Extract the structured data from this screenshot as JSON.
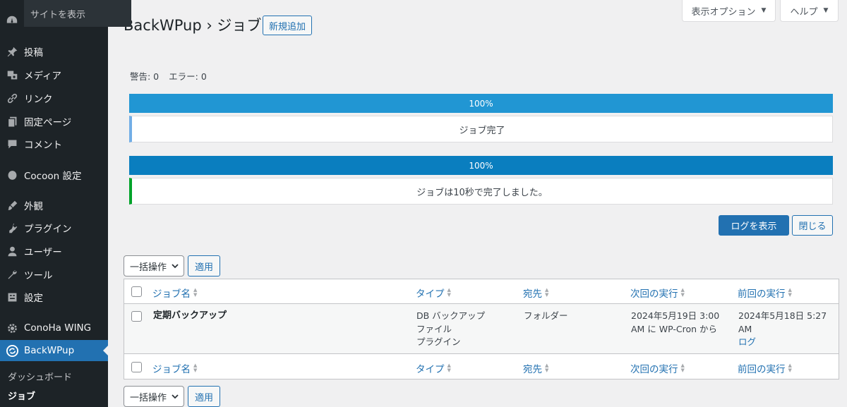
{
  "sidebar": {
    "tooltip": "サイトを表示",
    "items": [
      {
        "label": "投稿",
        "icon": "pin-icon"
      },
      {
        "label": "メディア",
        "icon": "media-icon"
      },
      {
        "label": "リンク",
        "icon": "link-icon"
      },
      {
        "label": "固定ページ",
        "icon": "page-icon"
      },
      {
        "label": "コメント",
        "icon": "comment-icon"
      },
      {
        "label": "Cocoon 設定",
        "icon": "cocoon-icon"
      },
      {
        "label": "外観",
        "icon": "appearance-icon"
      },
      {
        "label": "プラグイン",
        "icon": "plugin-icon"
      },
      {
        "label": "ユーザー",
        "icon": "user-icon"
      },
      {
        "label": "ツール",
        "icon": "wrench-icon"
      },
      {
        "label": "設定",
        "icon": "settings-icon"
      },
      {
        "label": "ConoHa WING",
        "icon": "gear-icon"
      },
      {
        "label": "BackWPup",
        "icon": "backwpup-icon"
      }
    ],
    "submenu": [
      "ダッシュボード",
      "ジョブ"
    ]
  },
  "header": {
    "title": "BackWPup › ジョブ",
    "add_new": "新規追加",
    "screen_options": "表示オプション",
    "help": "ヘルプ"
  },
  "status": {
    "warnings": "警告: 0",
    "errors": "エラー: 0"
  },
  "progress": [
    {
      "label": "100%",
      "value": 100,
      "message": "ジョブ完了",
      "bar_color": "#2196d3",
      "border_color": "#72aee6"
    },
    {
      "label": "100%",
      "value": 100,
      "message": "ジョブは10秒で完了しました。",
      "bar_color": "#0a7ebf",
      "border_color": "#00a32a"
    }
  ],
  "actions": {
    "view_log": "ログを表示",
    "close": "閉じる"
  },
  "bulk": {
    "select_label": "一括操作",
    "apply": "適用"
  },
  "table": {
    "columns": [
      "ジョブ名",
      "タイプ",
      "宛先",
      "次回の実行",
      "前回の実行"
    ],
    "rows": [
      {
        "name": "定期バックアップ",
        "type": [
          "DB バックアップ",
          "ファイル",
          "プラグイン"
        ],
        "destination": "フォルダー",
        "next_run": [
          "2024年5月19日 3:00",
          "AM に WP-Cron から"
        ],
        "last_run": [
          "2024年5月18日 5:27",
          "AM"
        ],
        "log_link": "ログ"
      }
    ]
  }
}
